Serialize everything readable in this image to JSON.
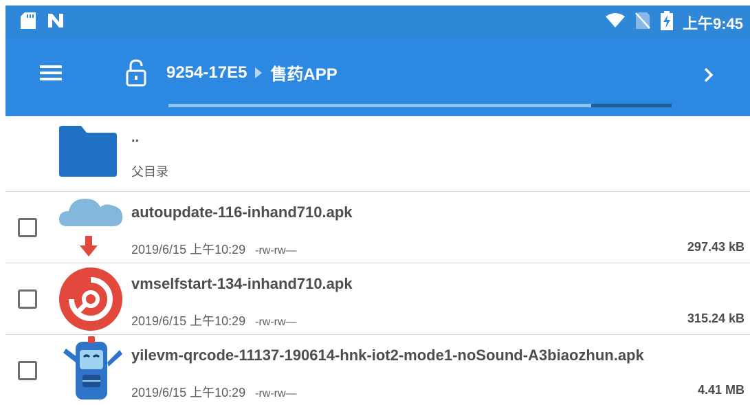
{
  "status_bar": {
    "time": "上午9:45",
    "icons": [
      "sd-card-icon",
      "n-logo-icon",
      "wifi-icon",
      "no-sim-icon",
      "battery-charging-icon"
    ]
  },
  "toolbar": {
    "menu_icon": "hamburger-menu-icon",
    "lock_icon": "lock-open-icon",
    "breadcrumb": [
      "9254-17E5",
      "售药APP"
    ],
    "next_icon": "chevron-right-icon",
    "progress": 0.84
  },
  "parent_dir": {
    "name": "..",
    "label": "父目录"
  },
  "files": [
    {
      "name": "autoupdate-116-inhand710.apk",
      "date": "2019/6/15 上午10:29",
      "perm": "-rw-rw—",
      "size": "297.43 kB",
      "icon": "cloud-download-icon"
    },
    {
      "name": "vmselfstart-134-inhand710.apk",
      "date": "2019/6/15 上午10:29",
      "perm": "-rw-rw—",
      "size": "315.24 kB",
      "icon": "red-circle-app-icon"
    },
    {
      "name": "yilevm-qrcode-11137-190614-hnk-iot2-mode1-noSound-A3biaozhun.apk",
      "date": "2019/6/15 上午10:29",
      "perm": "-rw-rw—",
      "size": "4.41 MB",
      "icon": "robot-app-icon"
    }
  ],
  "colors": {
    "status_bar": "#2f87d7",
    "toolbar": "#2c88e0",
    "folder": "#1f72c6"
  }
}
